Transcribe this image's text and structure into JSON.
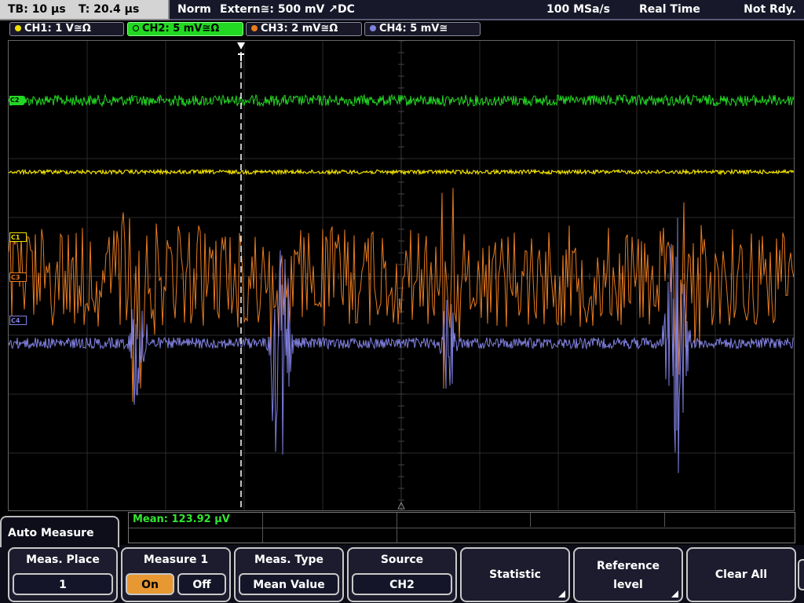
{
  "status": {
    "timebase": "TB: 10 µs",
    "trigger_time": "T: 20.4 µs",
    "trigger_mode": "Norm",
    "trigger_source": "Extern≅: 500 mV ↗DC",
    "sample_rate": "100 MSa/s",
    "acq_mode": "Real Time",
    "run_state": "Not Rdy."
  },
  "channels": [
    {
      "label": "CH1: 1 V≅Ω",
      "color": "#f0e000",
      "marker": "C1"
    },
    {
      "label": "CH2: 5 mV≅Ω",
      "color": "#22d822",
      "marker": "C2",
      "active": true
    },
    {
      "label": "CH3: 2 mV≅Ω",
      "color": "#e87b20",
      "marker": "C3"
    },
    {
      "label": "CH4: 5 mV≅",
      "color": "#8080e0",
      "marker": "C4"
    }
  ],
  "measurement": {
    "mean_readout": "Mean: 123.92 µV"
  },
  "menu": {
    "title": "Auto Measure",
    "meas_place": {
      "title": "Meas. Place",
      "value": "1"
    },
    "measure1": {
      "title": "Measure 1",
      "on": "On",
      "off": "Off"
    },
    "meas_type": {
      "title": "Meas. Type",
      "value": "Mean Value"
    },
    "source": {
      "title": "Source",
      "value": "CH2"
    },
    "statistic": "Statistic",
    "reference_line1": "Reference",
    "reference_line2": "level",
    "clear_all": "Clear All"
  },
  "colors": {
    "ch1": "#f0e000",
    "ch2": "#22d822",
    "ch3": "#e87b20",
    "ch4": "#8080e0"
  }
}
